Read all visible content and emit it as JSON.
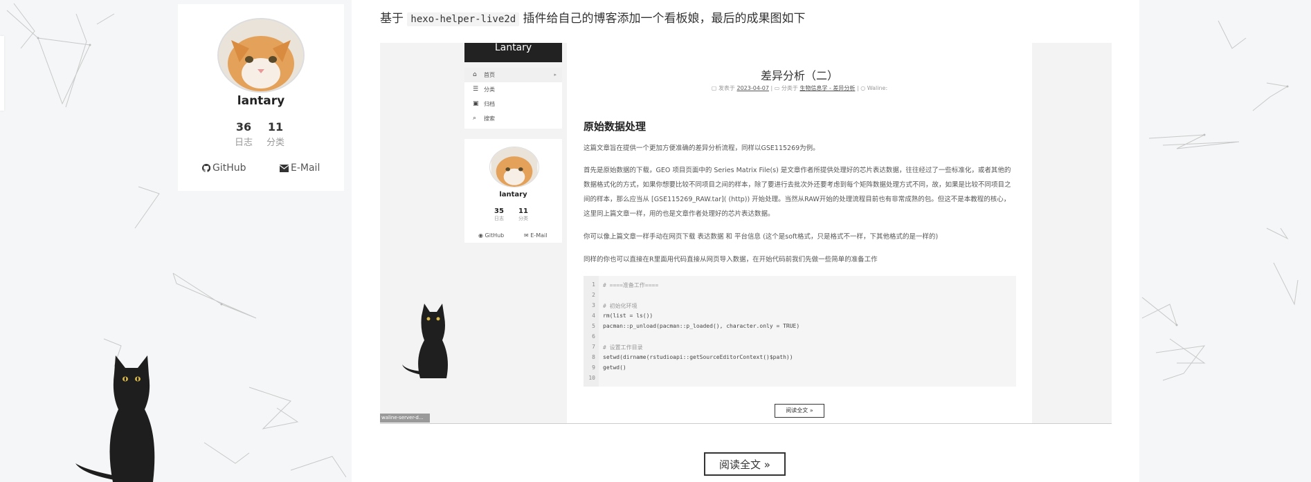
{
  "sidebar": {
    "profile": {
      "name": "lantary",
      "stats": [
        {
          "count": "36",
          "label": "日志"
        },
        {
          "count": "11",
          "label": "分类"
        }
      ],
      "links": [
        {
          "label": "GitHub",
          "icon": "github-icon"
        },
        {
          "label": "E-Mail",
          "icon": "envelope-icon"
        }
      ]
    }
  },
  "post": {
    "intro_prefix": "基于",
    "intro_code": "hexo-helper-live2d",
    "intro_suffix": "插件给自己的博客添加一个看板娘，最后的成果图如下",
    "read_more": "阅读全文 »"
  },
  "screenshot": {
    "site_title": "Lantary",
    "menu": [
      {
        "label": "首页",
        "icon": "home-icon"
      },
      {
        "label": "分类",
        "icon": "list-icon"
      },
      {
        "label": "归档",
        "icon": "archive-icon"
      },
      {
        "label": "搜索",
        "icon": "search-icon"
      }
    ],
    "profile": {
      "name": "lantary",
      "stats": [
        {
          "count": "35",
          "label": "日志"
        },
        {
          "count": "11",
          "label": "分类"
        }
      ],
      "links": [
        "GitHub",
        "E-Mail"
      ]
    },
    "article": {
      "title": "差异分析（二）",
      "meta_posted_prefix": "发表于",
      "meta_date": "2023-04-07",
      "meta_category_prefix": "分类于",
      "meta_category": "生物信息学 - 差异分析",
      "meta_comment": "Waline:",
      "heading": "原始数据处理",
      "paragraphs": [
        "这篇文章旨在提供一个更加方便准确的差异分析流程，同样以GSE115269为例。",
        "首先是原始数据的下载，GEO 项目页面中的 Series Matrix File(s) 是文章作者所提供处理好的芯片表达数据，往往经过了一些标准化，或者其他的数据格式化的方式，如果你想要比较不同项目之间的样本，除了要进行去批次外还要考虑到每个矩阵数据处理方式不同，故，如果是比较不同项目之间的样本，那么应当从 [GSE115269_RAW.tar]( (http)) 开始处理。当然从RAW开始的处理流程目前也有非常成熟的包。但这不是本教程的核心，这里同上篇文章一样，用的也是文章作者处理好的芯片表达数据。",
        "你可以像上篇文章一样手动在网页下载 表达数据 和 平台信息 (这个是soft格式，只是格式不一样，下其他格式的是一样的)",
        "同样的你也可以直接在R里面用代码直接从网页导入数据，在开始代码前我们先做一些简单的准备工作"
      ],
      "code_lines": [
        {
          "n": "1",
          "text": "# ====准备工作===="
        },
        {
          "n": "2",
          "text": ""
        },
        {
          "n": "3",
          "text": "# 初始化环境"
        },
        {
          "n": "4",
          "text": "rm(list = ls())"
        },
        {
          "n": "5",
          "text": "pacman::p_unload(pacman::p_loaded(), character.only = TRUE)"
        },
        {
          "n": "6",
          "text": ""
        },
        {
          "n": "7",
          "text": "# 设置工作目录"
        },
        {
          "n": "8",
          "text": "setwd(dirname(rstudioapi::getSourceEditorContext()$path))"
        },
        {
          "n": "9",
          "text": "getwd()"
        },
        {
          "n": "10",
          "text": ""
        }
      ],
      "read_more": "阅读全文 »"
    },
    "status_bar": "waline-server-d..."
  },
  "colors": {
    "page_background": "#f5f6f7",
    "card_background": "#ffffff",
    "header_dark": "#222222",
    "code_background": "#f5f5f5"
  }
}
